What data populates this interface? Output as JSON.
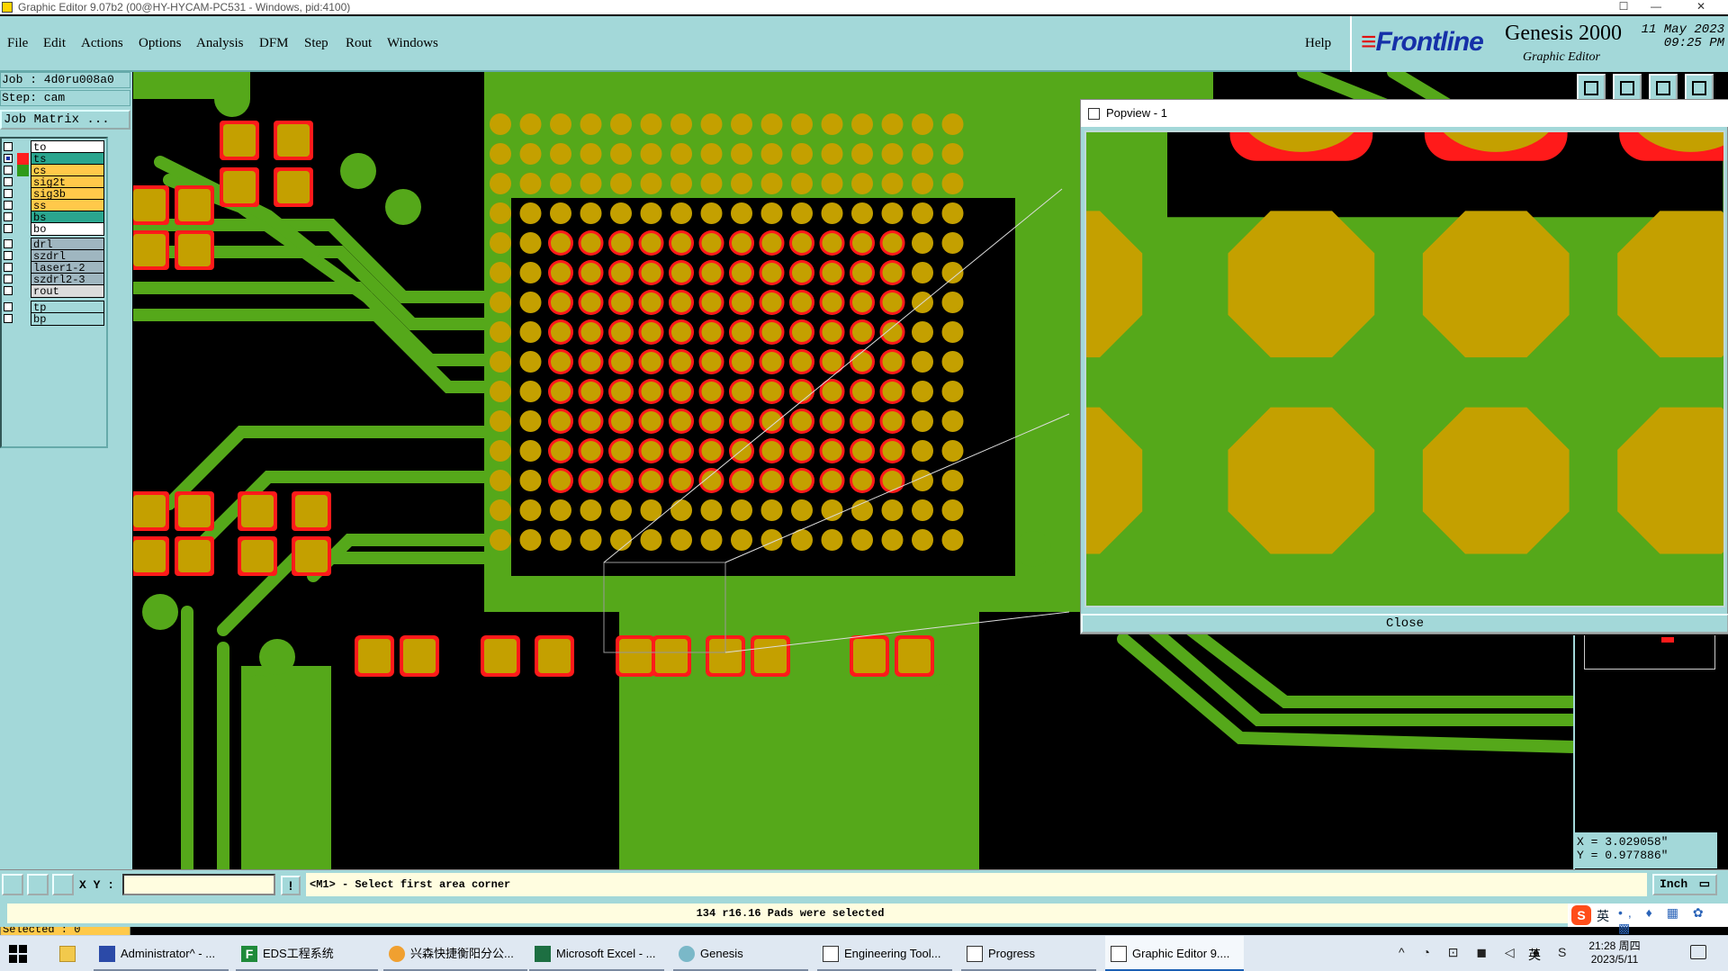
{
  "window": {
    "title": "Graphic Editor 9.07b2 (00@HY-HYCAM-PC531 - Windows, pid:4100)",
    "minimize": "—",
    "maximize": "☐",
    "close": "✕"
  },
  "menu": {
    "items": [
      "File",
      "Edit",
      "Actions",
      "Options",
      "Analysis",
      "DFM",
      "Step",
      "Rout",
      "Windows"
    ],
    "help": "Help"
  },
  "brand": {
    "logo": "Frontline",
    "product": "Genesis 2000",
    "subproduct": "Graphic Editor",
    "date": "11 May 2023",
    "time": "09:25 PM"
  },
  "info": {
    "job": "Job : 4d0ru008a0",
    "step": "Step: cam",
    "job_matrix": "Job Matrix ..."
  },
  "layers": [
    {
      "name": "to",
      "color": "#ffffff",
      "swatch": ""
    },
    {
      "name": "ts",
      "color": "#2aa58e",
      "swatch": "#ff2020",
      "active": true
    },
    {
      "name": "cs",
      "color": "#ffc94a",
      "swatch": "#2f9a1a"
    },
    {
      "name": "sig2t",
      "color": "#ffc94a",
      "swatch": ""
    },
    {
      "name": "sig3b",
      "color": "#ffc94a",
      "swatch": ""
    },
    {
      "name": "ss",
      "color": "#ffc94a",
      "swatch": ""
    },
    {
      "name": "bs",
      "color": "#2aa58e",
      "swatch": ""
    },
    {
      "name": "bo",
      "color": "#ffffff",
      "swatch": ""
    },
    {
      "name": "drl",
      "color": "#9fb6c0",
      "swatch": ""
    },
    {
      "name": "szdrl",
      "color": "#9fb6c0",
      "swatch": ""
    },
    {
      "name": "laser1-2",
      "color": "#9fb6c0",
      "swatch": ""
    },
    {
      "name": "szdrl2-3",
      "color": "#9fb6c0",
      "swatch": ""
    },
    {
      "name": "rout",
      "color": "#dcdcdc",
      "swatch": ""
    },
    {
      "name": "tp",
      "color": "#a3d8d9",
      "swatch": ""
    },
    {
      "name": "bp",
      "color": "#a3d8d9",
      "swatch": ""
    }
  ],
  "selected": "Selected : 0",
  "popview": {
    "title": "Popview - 1",
    "close_label": "Close"
  },
  "coords": {
    "x": "X = 3.029058\"",
    "y": "Y = 0.977886\""
  },
  "command": {
    "xy_label": "X Y :",
    "xy_value": "",
    "info": "!",
    "prompt": "<M1> - Select first area corner",
    "unit": "Inch"
  },
  "status": "134 r16.16 Pads were selected",
  "ime": {
    "lang": "英",
    "dots": "•, ♦ ▦ ✿ ▩"
  },
  "taskbar": {
    "tasks": [
      {
        "label": "Administrator^ - ...",
        "icon": "save-icon"
      },
      {
        "label": "EDS工程系统",
        "icon": "f-app-icon"
      },
      {
        "label": "兴森快捷衡阳分公...",
        "icon": "browser-icon"
      },
      {
        "label": "Microsoft Excel - ...",
        "icon": "excel-icon"
      },
      {
        "label": "Genesis",
        "icon": "genesis-icon"
      },
      {
        "label": "Engineering Tool...",
        "icon": "tool-icon"
      },
      {
        "label": "Progress",
        "icon": "progress-icon"
      },
      {
        "label": "Graphic Editor 9....",
        "icon": "editor-icon"
      }
    ],
    "tray_icons": "^ ◔ ⊡ ◼ ◁ ● S",
    "ime_char": "英",
    "time": "21:28 周四",
    "date": "2023/5/11"
  },
  "colors": {
    "board_green": "#55a81a",
    "pad_gold": "#c4a000",
    "soldermask_red": "#ff1a1a",
    "background": "#000000",
    "ui_teal": "#a3d8d9"
  }
}
